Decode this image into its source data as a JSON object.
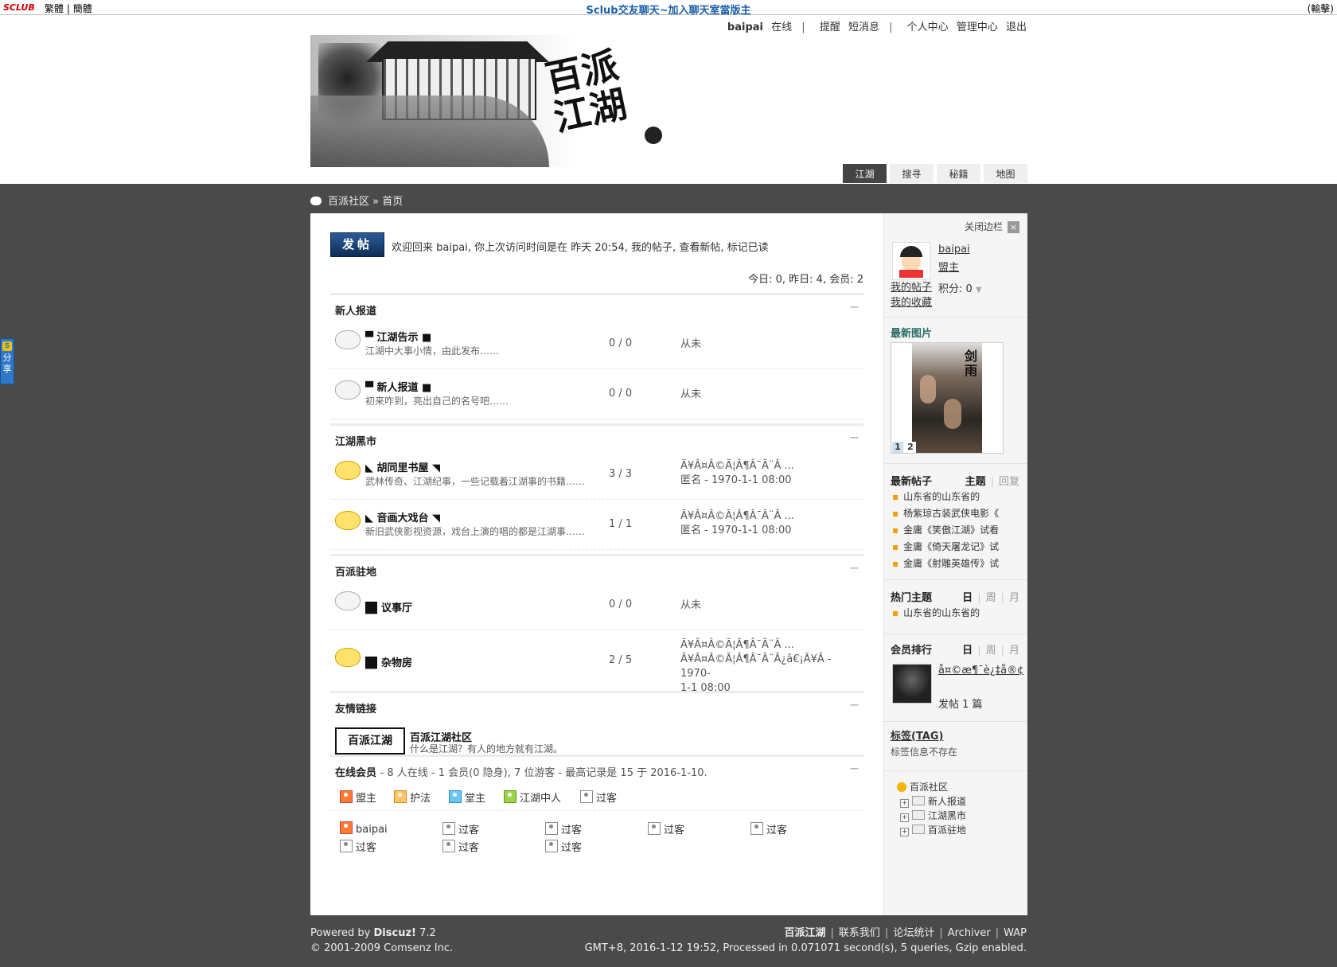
{
  "topbar": {
    "sclub": "SCLUB",
    "trad": "繁體",
    "simp": "簡體",
    "center_title": "Sclub交友聊天~加入聊天室當版主",
    "right": "(輸擊)"
  },
  "usernav": {
    "username": "baipai",
    "online": "在线",
    "remind": "提醒",
    "pm": "短消息",
    "profile": "个人中心",
    "admin": "管理中心",
    "logout": "退出"
  },
  "banner": {
    "logo_text": "百派江湖"
  },
  "tabs": [
    "江湖",
    "搜寻",
    "秘籍",
    "地图"
  ],
  "breadcrumb": {
    "home": "百派社区",
    "sep": "»",
    "current": "首页"
  },
  "main": {
    "post_button": "发帖",
    "welcome": "欢迎回来 baipai, 你上次访问时间是在 昨天 20:54, 我的帖子, 查看新帖, 标记已读",
    "stats": "今日: 0, 昨日: 4, 会员: 2",
    "collapse_symbol": "—",
    "sections": [
      {
        "title": "新人报道",
        "forums": [
          {
            "name": "▀ 江湖告示 ■",
            "desc": "江湖中大事小情，由此发布……",
            "count": "0 / 0",
            "last": [
              "从未"
            ],
            "new": false
          },
          {
            "name": "▀ 新人报道 ■",
            "desc": "初来咋到，亮出自己的名号吧……",
            "count": "0 / 0",
            "last": [
              "从未"
            ],
            "new": false
          }
        ]
      },
      {
        "title": "江湖黑市",
        "forums": [
          {
            "name": "◣ 胡同里书屋 ◥",
            "desc": "武林传奇、江湖纪事，一些记载着江湖事的书籍……",
            "count": "3 / 3",
            "last": [
              "Ã¥Â¤Â©Ã¦Â¶Â¯Ã¨Â ...",
              "匿名 - 1970-1-1 08:00"
            ],
            "new": true
          },
          {
            "name": "◣ 音画大戏台 ◥",
            "desc": "新旧武侠影视资源，戏台上演的唱的都是江湖事……",
            "count": "1 / 1",
            "last": [
              "Ã¥Â¤Â©Ã¦Â¶Â¯Ã¨Â ...",
              "匿名 - 1970-1-1 08:00"
            ],
            "new": true
          }
        ]
      },
      {
        "title": "百派驻地",
        "forums": [
          {
            "name": "█▌议事厅",
            "desc": "",
            "count": "0 / 0",
            "last": [
              "从未"
            ],
            "new": false
          },
          {
            "name": "█▌杂物房",
            "desc": "",
            "count": "2 / 5",
            "last": [
              "Ã¥Â¤Â©Ã¦Â¶Â¯Ã¨Â ...",
              "Ã¥Â¤Â©Ã¦Â¶Â¯Ã¨Â¿â€¡Ã¥Â - 1970-",
              "1-1 08:00"
            ],
            "new": true
          }
        ]
      }
    ],
    "links_title": "友情链接",
    "link": {
      "logo": "百派江湖",
      "name": "百派江湖社区",
      "desc": "什么是江湖？有人的地方就有江湖。"
    },
    "online_title": "在线会员",
    "online_summary": "- 8 人在线 - 1 会员(0 隐身), 7 位游客 - 最高记录是 15 于 2016-1-10.",
    "legend": [
      "盟主",
      "护法",
      "堂主",
      "江湖中人",
      "过客"
    ],
    "online_users": [
      "baipai",
      "过客",
      "过客",
      "过客",
      "过客",
      "过客",
      "过客",
      "过客"
    ]
  },
  "side": {
    "close_label": "关闭边栏",
    "close_x": "×",
    "username": "baipai",
    "group": "盟主",
    "my_posts": "我的帖子",
    "my_fav": "我的收藏",
    "score": "积分: 0",
    "latest_pics_title": "最新图片",
    "poster_text": "剑雨",
    "pic_pages": [
      "1",
      "2"
    ],
    "latest_posts_title": "最新帖子",
    "latest_posts_tab_on": "主题",
    "latest_posts_tab_off": "回复",
    "latest_posts": [
      "山东省的山东省的",
      "杨紫琼古装武侠电影《",
      "金庸《笑傲江湖》试看",
      "金庸《倚天屠龙记》试",
      "金庸《射雕英雄传》试"
    ],
    "hot_title": "热门主题",
    "period_tabs": [
      "日",
      "周",
      "月"
    ],
    "hot_posts": [
      "山东省的山东省的"
    ],
    "rank_title": "会员排行",
    "rank_name": "å¤©æ¶¯è¿‡å®¢",
    "rank_posts": "发帖 1 篇",
    "tag_title": "标签(TAG)",
    "tag_text": "标签信息不存在",
    "tree_root": "百派社区",
    "tree_nodes": [
      "新人报道",
      "江湖黑市",
      "百派驻地"
    ]
  },
  "share": "分享",
  "footer": {
    "powered": "Powered by",
    "product": "Discuz!",
    "version": " 7.2",
    "copyright": "© 2001-2009 Comsenz Inc.",
    "links": [
      "百派江湖",
      "联系我们",
      "论坛统计",
      "Archiver",
      "WAP"
    ],
    "info": "GMT+8, 2016-1-12 19:52, Processed in 0.071071 second(s), 5 queries, Gzip enabled."
  }
}
